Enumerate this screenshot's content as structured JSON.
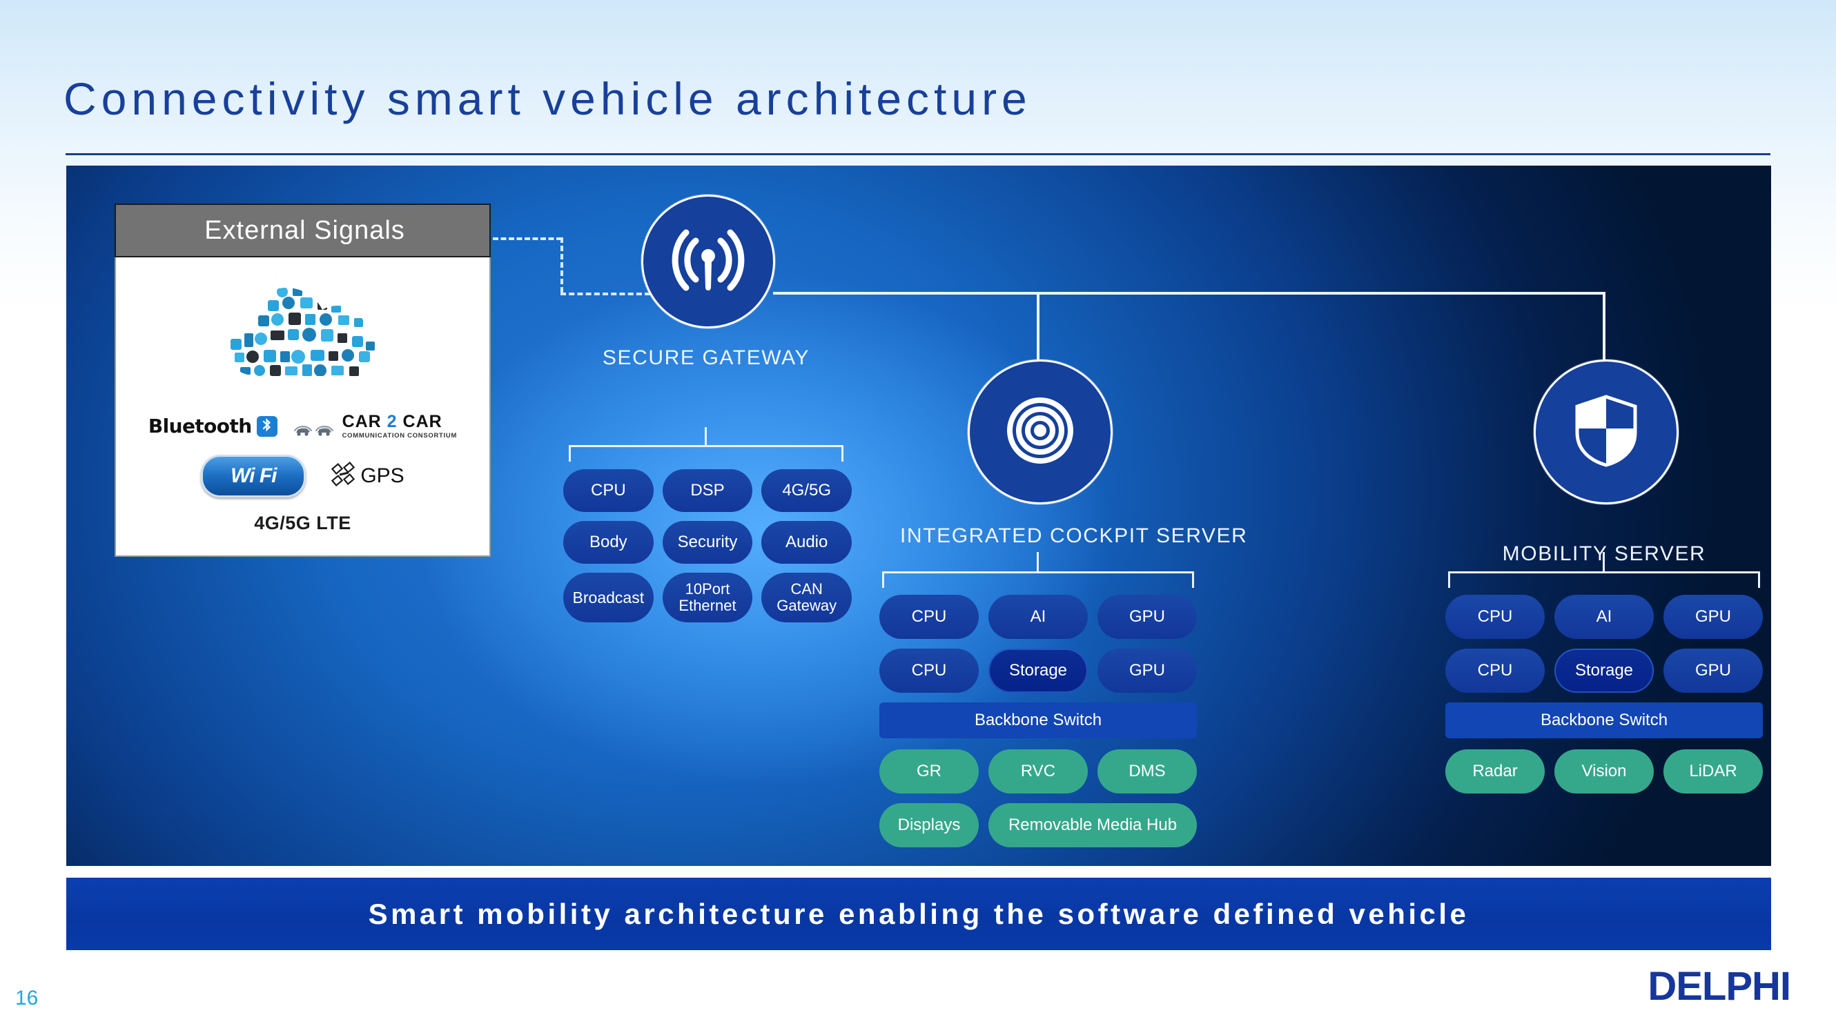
{
  "slide": {
    "title": "Connectivity smart vehicle architecture",
    "page_number": "16",
    "brand": "DELPHI",
    "banner": "Smart mobility architecture enabling the software defined vehicle"
  },
  "external_signals": {
    "header": "External  Signals",
    "cloud_icon": "icon-cloud-of-icons",
    "logos": [
      {
        "name": "bluetooth",
        "word": "Bluetooth",
        "mark": "bluetooth-rune"
      },
      {
        "name": "car2car",
        "main_1": "CAR ",
        "main_2": "2",
        "main_3": " CAR",
        "sub": "COMMUNICATION CONSORTIUM"
      },
      {
        "name": "wifi",
        "word": "Wi Fi"
      },
      {
        "name": "gps",
        "word": "GPS",
        "mark": "satellite-icon"
      }
    ],
    "footnote": "4G/5G LTE"
  },
  "nodes": {
    "secure_gateway": {
      "label": "SECURE GATEWAY",
      "icon": "broadcast-antenna-icon",
      "rows": [
        [
          "CPU",
          "DSP",
          "4G/5G"
        ],
        [
          "Body",
          "Security",
          "Audio"
        ],
        [
          "Broadcast",
          "10Port\nEthernet",
          "CAN\nGateway"
        ]
      ]
    },
    "integrated_cockpit_server": {
      "label": "INTEGRATED COCKPIT SERVER",
      "icon": "radar-signal-icon",
      "compute_rows": [
        [
          {
            "label": "CPU",
            "style": "blue"
          },
          {
            "label": "AI",
            "style": "blue"
          },
          {
            "label": "GPU",
            "style": "blue"
          }
        ],
        [
          {
            "label": "CPU",
            "style": "blue"
          },
          {
            "label": "Storage",
            "style": "blue-dark"
          },
          {
            "label": "GPU",
            "style": "blue"
          }
        ]
      ],
      "switch": "Backbone Switch",
      "peripherals_row1": [
        "GR",
        "RVC",
        "DMS"
      ],
      "peripherals_row2": [
        "Displays",
        "Removable Media Hub"
      ]
    },
    "mobility_server": {
      "label": "MOBILITY SERVER",
      "icon": "shield-icon",
      "compute_rows": [
        [
          {
            "label": "CPU",
            "style": "blue"
          },
          {
            "label": "AI",
            "style": "blue"
          },
          {
            "label": "GPU",
            "style": "blue"
          }
        ],
        [
          {
            "label": "CPU",
            "style": "blue"
          },
          {
            "label": "Storage",
            "style": "blue-dark"
          },
          {
            "label": "GPU",
            "style": "blue"
          }
        ]
      ],
      "switch": "Backbone Switch",
      "sensors": [
        "Radar",
        "Vision",
        "LiDAR"
      ]
    }
  },
  "colors": {
    "title_blue": "#18409a",
    "node_blue": "#15409c",
    "pill_blue": "#12379a",
    "pill_blue_dark": "#06228a",
    "pill_green": "#35a88c",
    "banner_blue": "#0837a3",
    "page_number_blue": "#26a3dc",
    "header_gray": "#737373"
  }
}
